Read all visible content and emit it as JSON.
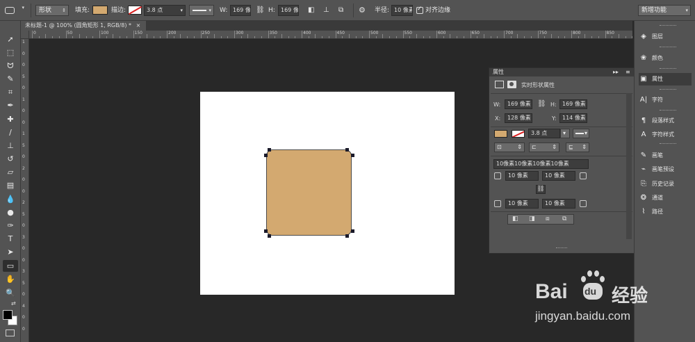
{
  "options_bar": {
    "tool_mode": "形状",
    "fill_label": "填充:",
    "stroke_label": "描边:",
    "stroke_width": "3.8 点",
    "w_label": "W:",
    "w_value": "169 像",
    "h_label": "H:",
    "h_value": "169 像",
    "radius_label": "半径:",
    "radius_value": "10 像素",
    "align_edges_label": "对齐边缘",
    "align_edges_checked": true,
    "workspace": "新增功能",
    "fill_color": "#d3a970"
  },
  "document": {
    "tab_title": "未标题-1 @ 100% (圆角矩形 1, RGB/8) *",
    "ruler_top_labels": [
      "0",
      "50",
      "100",
      "150",
      "200",
      "250",
      "300",
      "350",
      "400",
      "450",
      "500",
      "550",
      "600",
      "650",
      "700",
      "750",
      "800",
      "850",
      "900"
    ],
    "ruler_left_labels": [
      "1",
      "0",
      "0",
      "5",
      "0",
      "1",
      "0",
      "0",
      "1",
      "5",
      "0",
      "2",
      "0",
      "0",
      "2",
      "5",
      "0",
      "3",
      "0",
      "0",
      "3",
      "5",
      "0",
      "4",
      "0",
      "0"
    ]
  },
  "properties_panel": {
    "panel_title": "属性",
    "section_title": "实时形状属性",
    "w_label": "W:",
    "w_value": "169 像素",
    "h_label": "H:",
    "h_value": "169 像素",
    "x_label": "X:",
    "x_value": "128 像素",
    "y_label": "Y:",
    "y_value": "114 像素",
    "stroke_width": "3.8 点",
    "corner_all": "10像素10像素10像素10像素",
    "corner_tl": "10 像素",
    "corner_tr": "10 像素",
    "corner_bl": "10 像素",
    "corner_br": "10 像素",
    "fill_color": "#d3a970"
  },
  "right_dock": {
    "items": [
      {
        "label": "图层",
        "icon": "layers-icon"
      },
      {
        "label": "颜色",
        "icon": "color-icon"
      },
      {
        "label": "属性",
        "icon": "properties-icon"
      },
      {
        "label": "字符",
        "icon": "character-icon"
      },
      {
        "label": "段落样式",
        "icon": "paragraph-style-icon"
      },
      {
        "label": "字符样式",
        "icon": "character-style-icon"
      },
      {
        "label": "画笔",
        "icon": "brush-icon"
      },
      {
        "label": "画笔预设",
        "icon": "brush-presets-icon"
      },
      {
        "label": "历史记录",
        "icon": "history-icon"
      },
      {
        "label": "通道",
        "icon": "channels-icon"
      },
      {
        "label": "路径",
        "icon": "paths-icon"
      }
    ]
  },
  "watermark": {
    "brand": "Bai",
    "brand2": "du",
    "product": "经验",
    "url": "jingyan.baidu.com"
  }
}
